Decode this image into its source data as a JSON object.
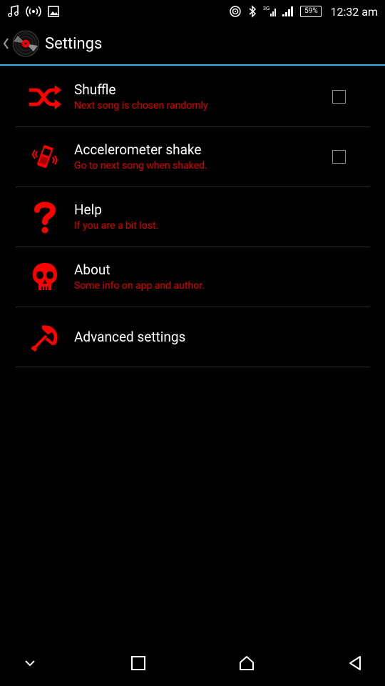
{
  "status_bar": {
    "time": "12:32 am",
    "battery": "59%",
    "left_icons": [
      "music-icon",
      "hotspot-icon",
      "image-icon"
    ],
    "right_icons": [
      "nfc-icon",
      "bluetooth-icon",
      "signal-3g-icon",
      "signal-bars-icon",
      "battery-icon"
    ]
  },
  "action_bar": {
    "title": "Settings",
    "logo": "vinyl-record-icon"
  },
  "settings": [
    {
      "title": "Shuffle",
      "summary": "Next song is chosen randomly",
      "icon": "shuffle-icon",
      "has_checkbox": true,
      "checked": false
    },
    {
      "title": "Accelerometer shake",
      "summary": "Go to next song when shaked.",
      "icon": "vibrating-phone-icon",
      "has_checkbox": true,
      "checked": false
    },
    {
      "title": "Help",
      "summary": "If you are a bit lost.",
      "icon": "question-mark-icon",
      "has_checkbox": false
    },
    {
      "title": "About",
      "summary": "Some info on app and author.",
      "icon": "skull-icon",
      "has_checkbox": false
    },
    {
      "title": "Advanced settings",
      "summary": "",
      "icon": "hammer-sickle-icon",
      "has_checkbox": false
    }
  ],
  "nav_bar": {
    "buttons": [
      "chevron-down-icon",
      "recents-icon",
      "home-icon",
      "back-icon"
    ]
  },
  "colors": {
    "background": "#000000",
    "accent": "#33b5e5",
    "summary_red": "#e00000",
    "icon_red": "#ff0000",
    "divider": "#2a2a2a"
  }
}
